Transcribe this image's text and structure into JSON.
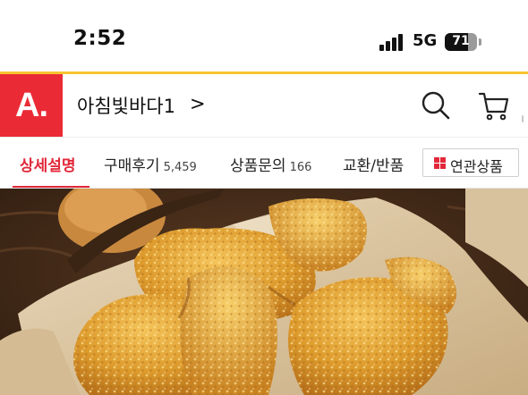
{
  "status_bar": {
    "time": "2:52",
    "network": "5G",
    "battery": "71",
    "battery_level": 0.71
  },
  "header": {
    "logo_text": "A.",
    "store_name": "아침빛바다1",
    "store_chevron": ">",
    "icons": [
      "search-icon",
      "cart-icon"
    ]
  },
  "tabs": {
    "items": [
      {
        "label": "상세설명",
        "count": ""
      },
      {
        "label": "구매후기",
        "count": "5,459"
      },
      {
        "label": "상품문의",
        "count": "166"
      },
      {
        "label": "교환/반품",
        "count": ""
      }
    ],
    "related_label": "연관상품"
  },
  "colors": {
    "brand_red": "#ea2b36",
    "accent_yellow": "#f7c531",
    "active_tab": "#e2283a"
  }
}
